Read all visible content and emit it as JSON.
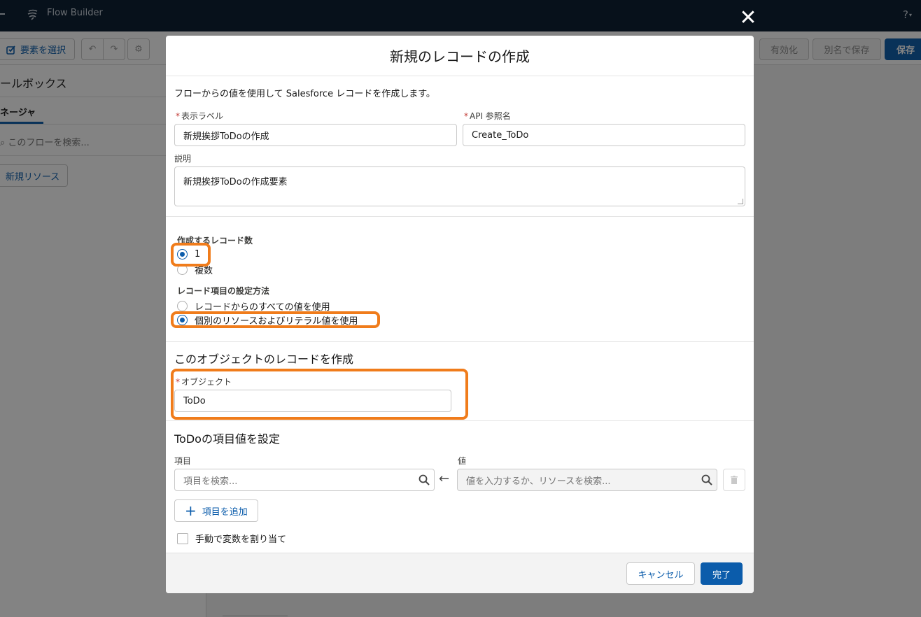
{
  "app": {
    "title": "Flow Builder",
    "help_label": "?",
    "toolbar": {
      "select_elements": "要素を選択",
      "activate": "有効化",
      "save_as": "別名で保存",
      "save": "保存"
    },
    "sidebar": {
      "title": "ールボックス",
      "tab_manager": "ネージャ",
      "search_placeholder": "このフローを検索...",
      "new_resource": "新規リソース"
    }
  },
  "modal": {
    "title": "新規のレコードの作成",
    "close_label": "✕",
    "description_text": "フローからの値を使用して Salesforce レコードを作成します。",
    "label_field": {
      "label": "表示ラベル",
      "value": "新規挨拶ToDoの作成"
    },
    "api_name_field": {
      "label": "API 参照名",
      "value": "Create_ToDo"
    },
    "description_field": {
      "label": "説明",
      "value": "新規挨拶ToDoの作成要素"
    },
    "record_count": {
      "label": "作成するレコード数",
      "options": [
        "1",
        "複数"
      ],
      "selected": "1"
    },
    "field_setting_method": {
      "label": "レコード項目の設定方法",
      "options": [
        "レコードからのすべての値を使用",
        "個別のリソースおよびリテラル値を使用"
      ],
      "selected": "個別のリソースおよびリテラル値を使用"
    },
    "object_section": {
      "title": "このオブジェクトのレコードを作成",
      "object_label": "オブジェクト",
      "object_value": "ToDo"
    },
    "field_values_section": {
      "title": "ToDoの項目値を設定",
      "field_header": "項目",
      "value_header": "値",
      "field_placeholder": "項目を検索...",
      "value_placeholder": "値を入力するか、リソースを検索...",
      "add_field": "項目を追加"
    },
    "manual_assign": {
      "label": "手動で変数を割り当て",
      "checked": false
    },
    "footer": {
      "cancel": "キャンセル",
      "done": "完了"
    }
  },
  "colors": {
    "brand": "#0b5cab",
    "highlight": "#f07c1b",
    "required": "#c23934",
    "header_bg": "#061a2e"
  }
}
